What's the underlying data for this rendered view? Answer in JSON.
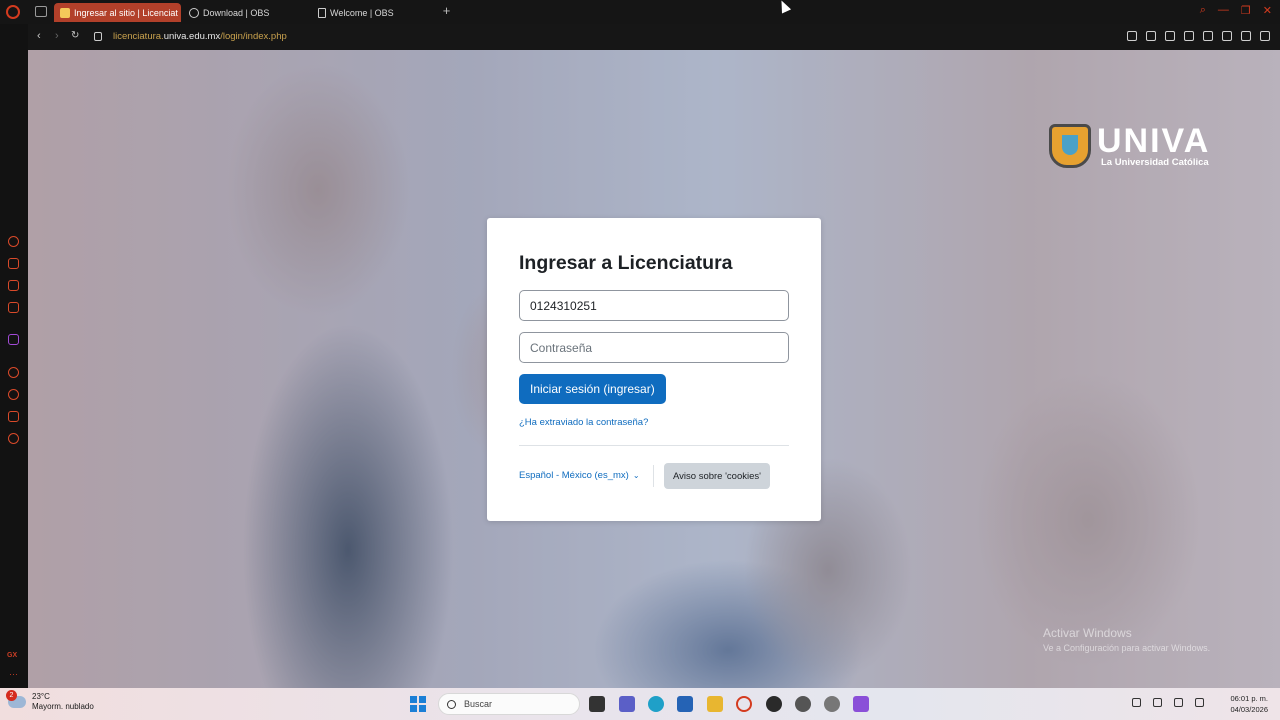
{
  "browser": {
    "tabs": [
      {
        "title": "Ingresar al sitio | Licenciat",
        "active": true
      },
      {
        "title": "Download | OBS",
        "active": false
      },
      {
        "title": "Welcome | OBS",
        "active": false
      }
    ],
    "new_tab_label": "+",
    "url": {
      "prefix": "licenciatura.",
      "domain": "univa.edu.mx",
      "path": "/login/index.php"
    },
    "accent_color": "#d43b1f"
  },
  "logo": {
    "name": "UNIVA",
    "tagline": "La Universidad Católica"
  },
  "login": {
    "title": "Ingresar a Licenciatura",
    "username_value": "0124310251",
    "password_placeholder": "Contraseña",
    "submit_label": "Iniciar sesión (ingresar)",
    "forgot_link": "¿Ha extraviado la contraseña?",
    "language_selected": "Español - México (es_mx)",
    "cookies_label": "Aviso sobre 'cookies'",
    "primary_color": "#0f6cbf"
  },
  "watermark": {
    "line1": "Activar Windows",
    "line2": "Ve a Configuración para activar Windows."
  },
  "taskbar": {
    "weather_temp": "23°C",
    "weather_desc": "Mayorm. nublado",
    "notification_count": "2",
    "search_placeholder": "Buscar",
    "time": "06:01 p. m.",
    "date": "04/03/2026"
  }
}
